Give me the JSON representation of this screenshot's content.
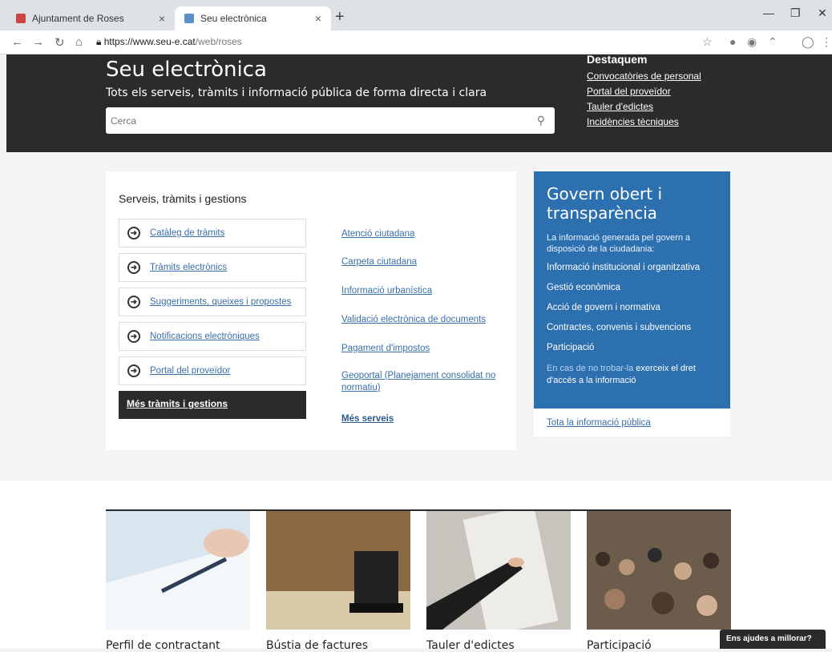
{
  "browser": {
    "tabs": [
      {
        "title": "Ajuntament de Roses"
      },
      {
        "title": "Seu electrònica"
      }
    ],
    "url_host": "https://www.seu-e.cat",
    "url_path": "/web/roses"
  },
  "header": {
    "title": "Seu electrònica",
    "subtitle": "Tots els serveis, tràmits i informació pública de forma directa i clara",
    "search_placeholder": "Cerca",
    "destaquem_title": "Destaquem",
    "destaquem_links": [
      "Convocatòries de personal",
      "Portal del proveïdor",
      "Tauler d'edictes",
      "Incidències tècniques"
    ]
  },
  "services": {
    "title": "Serveis, tràmits i gestions",
    "boxes": [
      "Catàleg de tràmits",
      "Tràmits electrònics",
      "Suggeriments, queixes i propostes",
      "Notificacions electròniques",
      "Portal del proveïdor"
    ],
    "more_button": "Més tràmits i gestions",
    "links": [
      "Atenció ciutadana",
      "Carpeta ciutadana",
      "Informació urbanística",
      "Validació electrònica de documents",
      "Pagament d'impostos",
      "Geoportal (Planejament consolidat no normatiu)"
    ],
    "more_link": "Més serveis"
  },
  "govern": {
    "title": "Govern obert i transparència",
    "lead": "La informació generada pel govern a disposició de la ciudadania:",
    "items": [
      "Informació institucional i organitzativa",
      "Gestió econòmica",
      "Acció de govern i normativa",
      "Contractes, convenis i subvencions",
      "Participació"
    ],
    "foot_light": "En cas de no trobar-la",
    "foot_text": " exerceix el dret d'accés a la informació",
    "bottom_link": "Tota la informació pública"
  },
  "tiles": [
    "Perfil de contractant",
    "Bústia de factures",
    "Tauler d'edictes",
    "Participació"
  ],
  "feedback": "Ens ajudes a millorar?",
  "colors": {
    "dark": "#2b2b2b",
    "gov_blue": "#2d70b0",
    "link": "#3a6fa8"
  }
}
